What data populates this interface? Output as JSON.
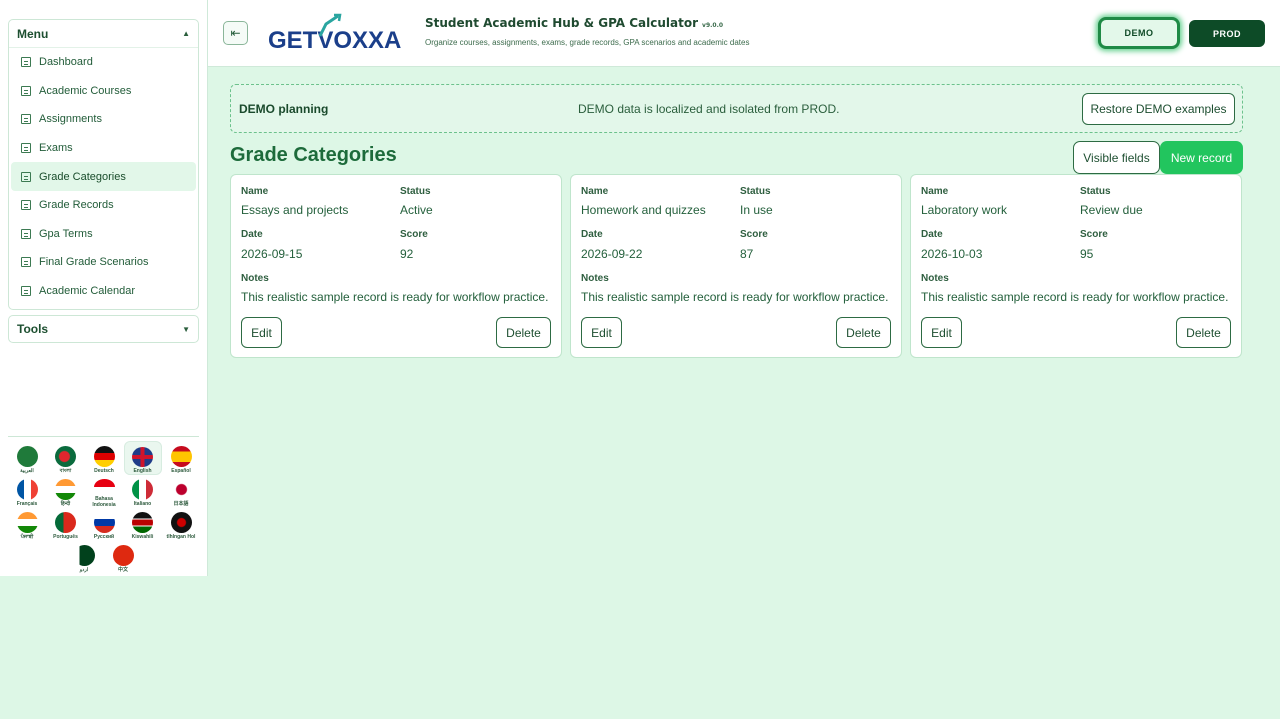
{
  "app": {
    "title": "Student Academic Hub & GPA Calculator",
    "version": "v9.0.0",
    "subtitle": "Organize courses, assignments, exams, grade records, GPA scenarios and academic dates",
    "logo_text": "GETVOXXA",
    "collapse_icon": "sidebar-collapse-icon"
  },
  "env": {
    "demo_label": "DEMO",
    "prod_label": "PROD"
  },
  "sidebar": {
    "menu_label": "Menu",
    "tools_label": "Tools",
    "items": [
      {
        "label": "Dashboard"
      },
      {
        "label": "Academic Courses"
      },
      {
        "label": "Assignments"
      },
      {
        "label": "Exams"
      },
      {
        "label": "Grade Categories"
      },
      {
        "label": "Grade Records"
      },
      {
        "label": "Gpa Terms"
      },
      {
        "label": "Final Grade Scenarios"
      },
      {
        "label": "Academic Calendar"
      }
    ],
    "active_item": "Grade Categories"
  },
  "languages": [
    {
      "label": "العربية",
      "flag": "sa"
    },
    {
      "label": "বাংলা",
      "flag": "bd"
    },
    {
      "label": "Deutsch",
      "flag": "de"
    },
    {
      "label": "English",
      "flag": "gb"
    },
    {
      "label": "Español",
      "flag": "es"
    },
    {
      "label": "Français",
      "flag": "fr"
    },
    {
      "label": "हिन्दी",
      "flag": "in"
    },
    {
      "label": "Bahasa Indonesia",
      "flag": "id"
    },
    {
      "label": "Italiano",
      "flag": "it"
    },
    {
      "label": "日本語",
      "flag": "jp"
    },
    {
      "label": "ਪੰਜਾਬੀ",
      "flag": "in"
    },
    {
      "label": "Português",
      "flag": "pt"
    },
    {
      "label": "Русский",
      "flag": "ru"
    },
    {
      "label": "Kiswahili",
      "flag": "ke"
    },
    {
      "label": "tlhIngan Hol",
      "flag": "kl"
    },
    {
      "label": "اردو",
      "flag": "pk"
    },
    {
      "label": "中文",
      "flag": "cn"
    }
  ],
  "active_language": "English",
  "banner": {
    "title": "DEMO planning",
    "message": "DEMO data is localized and isolated from PROD.",
    "restore_label": "Restore DEMO examples"
  },
  "main": {
    "title": "Grade Categories",
    "visible_fields_label": "Visible fields",
    "new_record_label": "New record",
    "field_labels": {
      "name": "Name",
      "status": "Status",
      "date": "Date",
      "score": "Score",
      "notes": "Notes"
    },
    "edit_label": "Edit",
    "delete_label": "Delete",
    "records": [
      {
        "name": "Essays and projects",
        "status": "Active",
        "date": "2026-09-15",
        "score": "92",
        "notes": "This realistic sample record is ready for workflow practice."
      },
      {
        "name": "Homework and quizzes",
        "status": "In use",
        "date": "2026-09-22",
        "score": "87",
        "notes": "This realistic sample record is ready for workflow practice."
      },
      {
        "name": "Laboratory work",
        "status": "Review due",
        "date": "2026-10-03",
        "score": "95",
        "notes": "This realistic sample record is ready for workflow practice."
      }
    ]
  },
  "colors": {
    "accent": "#22c55e",
    "brand_dark": "#0d4b27",
    "background": "#ddf7e6"
  }
}
